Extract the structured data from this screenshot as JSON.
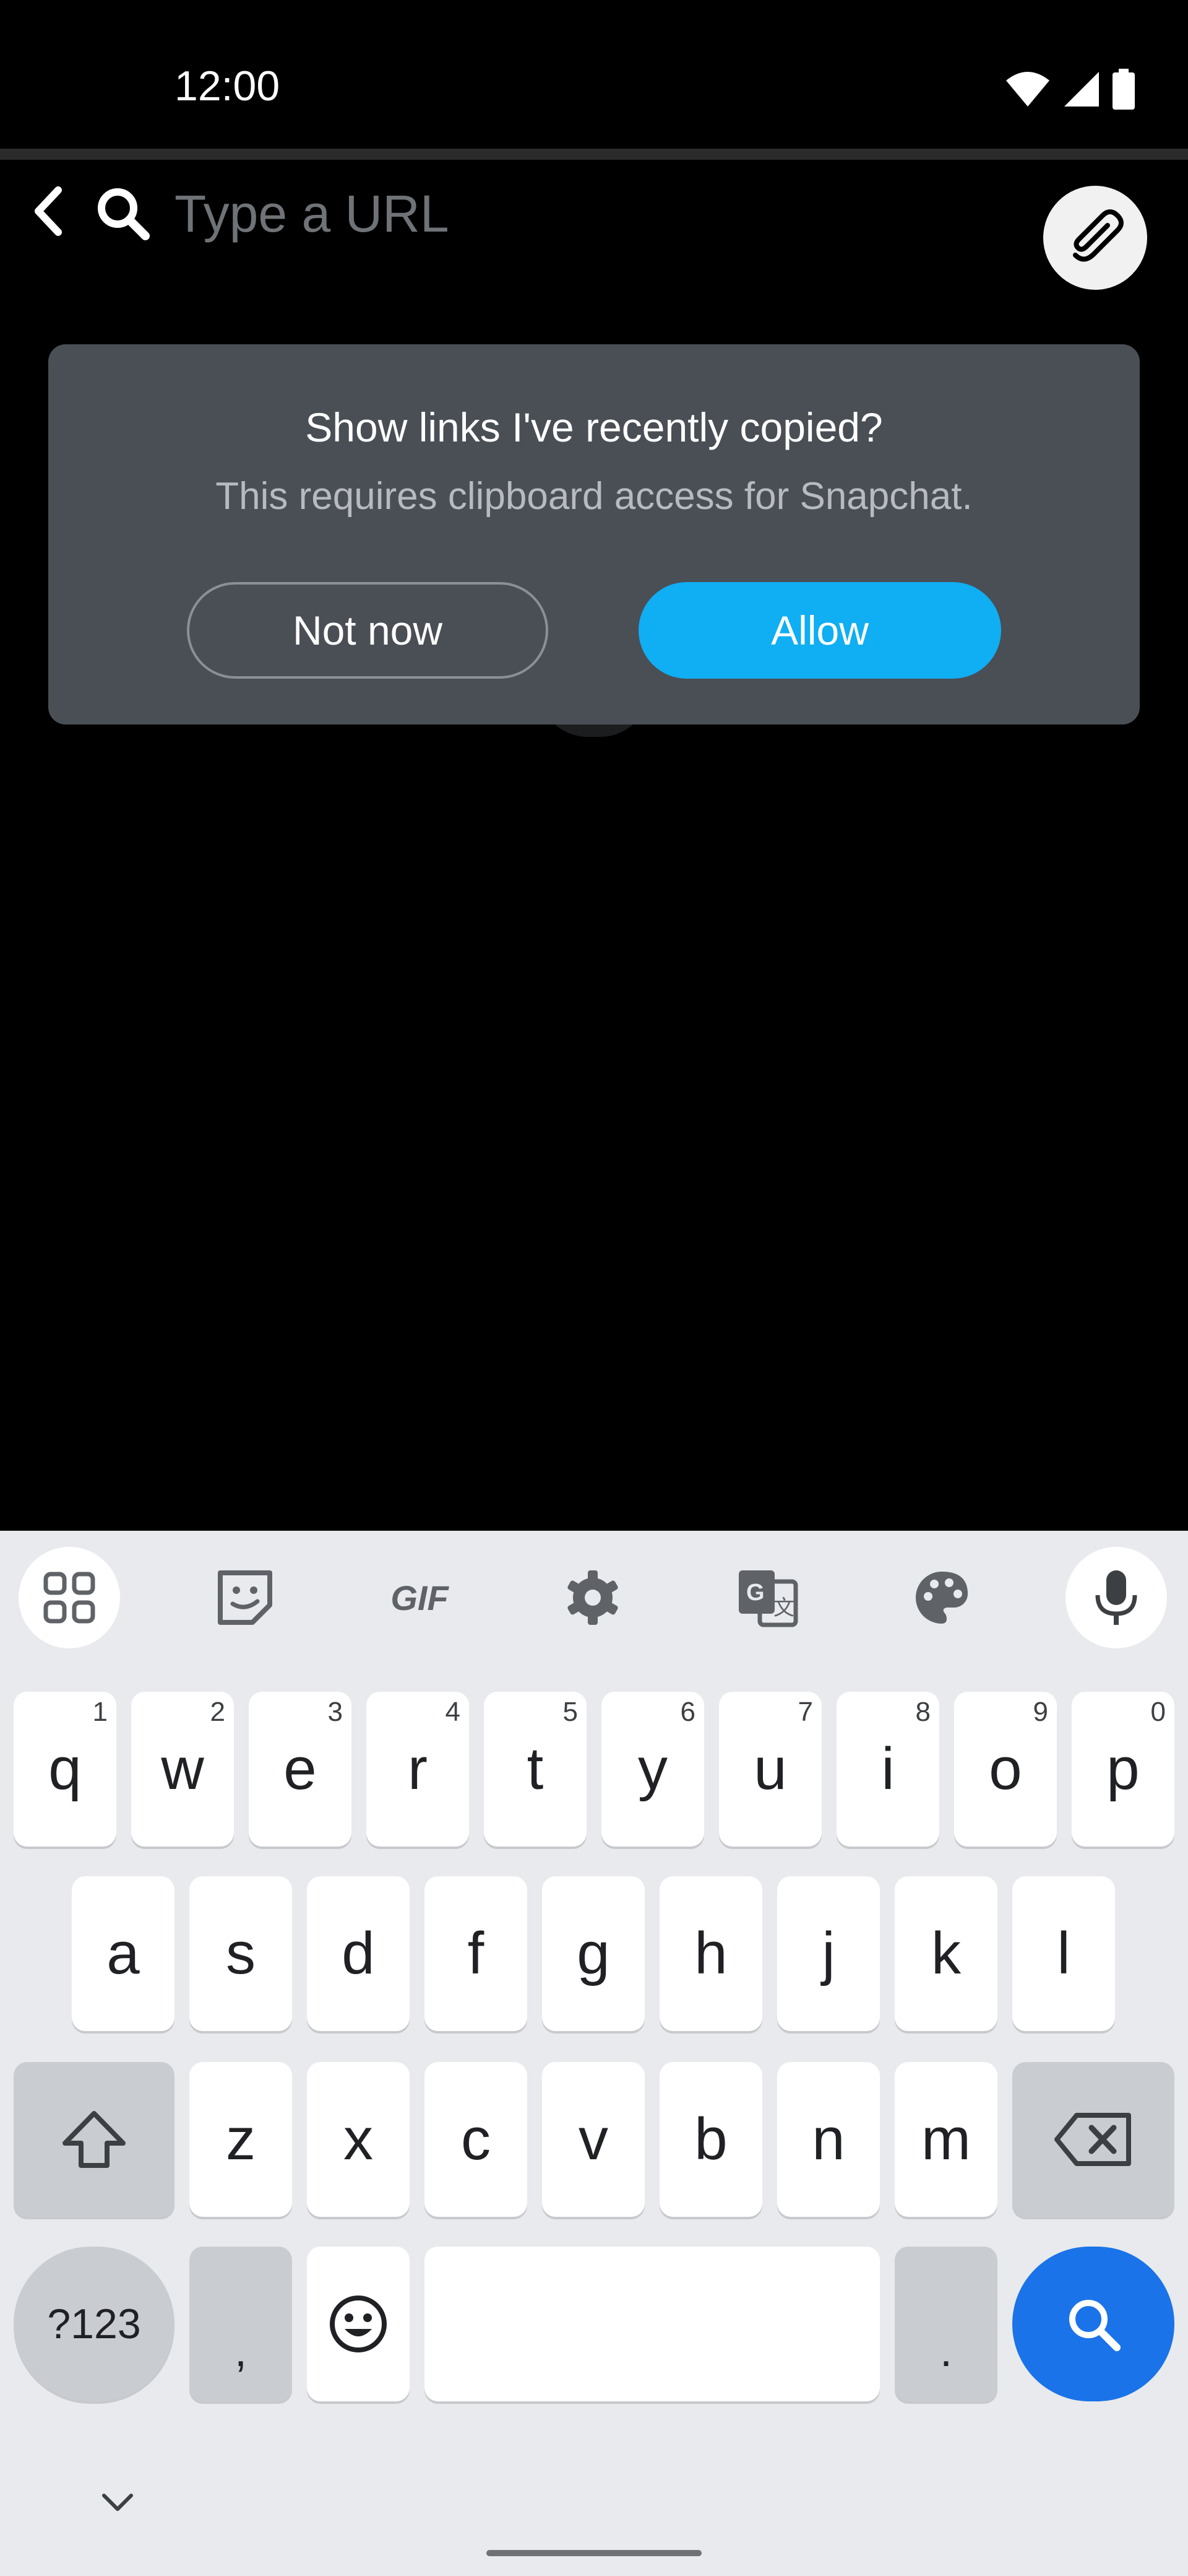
{
  "status_bar": {
    "time": "12:00"
  },
  "search": {
    "placeholder": "Type a URL"
  },
  "dialog": {
    "title": "Show links I've recently copied?",
    "subtitle": "This requires clipboard access for Snapchat.",
    "not_now_label": "Not now",
    "allow_label": "Allow"
  },
  "keyboard": {
    "gif_label": "GIF",
    "row1": [
      {
        "k": "q",
        "h": "1"
      },
      {
        "k": "w",
        "h": "2"
      },
      {
        "k": "e",
        "h": "3"
      },
      {
        "k": "r",
        "h": "4"
      },
      {
        "k": "t",
        "h": "5"
      },
      {
        "k": "y",
        "h": "6"
      },
      {
        "k": "u",
        "h": "7"
      },
      {
        "k": "i",
        "h": "8"
      },
      {
        "k": "o",
        "h": "9"
      },
      {
        "k": "p",
        "h": "0"
      }
    ],
    "row2": [
      "a",
      "s",
      "d",
      "f",
      "g",
      "h",
      "j",
      "k",
      "l"
    ],
    "row3": [
      "z",
      "x",
      "c",
      "v",
      "b",
      "n",
      "m"
    ],
    "symbols_label": "?123",
    "comma_label": ",",
    "period_label": "."
  },
  "colors": {
    "accent": "#10aef3",
    "search_key": "#1a73e8",
    "dialog_bg": "#4a4e55"
  }
}
